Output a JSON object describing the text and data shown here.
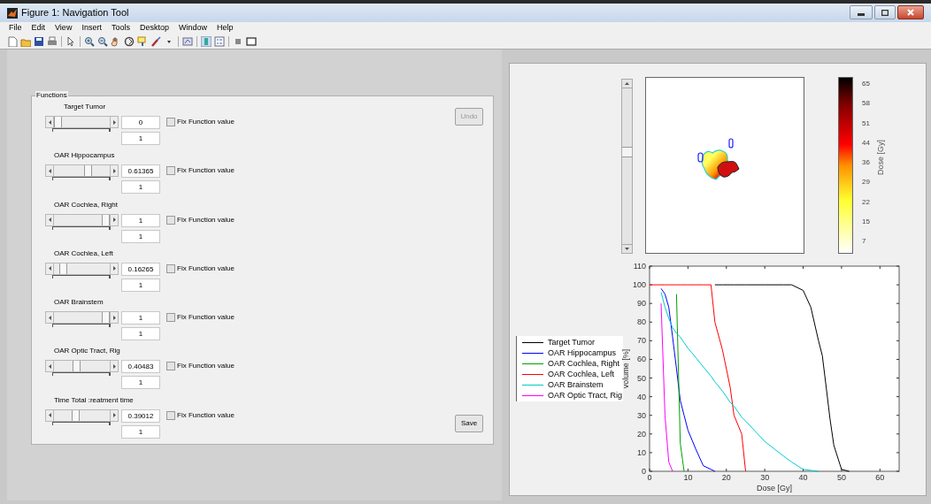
{
  "window": {
    "title": "Figure 1: Navigation Tool"
  },
  "menu": [
    "File",
    "Edit",
    "View",
    "Insert",
    "Tools",
    "Desktop",
    "Window",
    "Help"
  ],
  "functions_panel": {
    "title": "Functions",
    "rows": [
      {
        "label": "Target Tumor",
        "level": 0,
        "value": "0",
        "checkbox_label": "Fix Function value",
        "checked": false,
        "weight": "1"
      },
      {
        "label": "OAR Hippocampus",
        "level": 0.61365,
        "value": "0.61365",
        "checkbox_label": "Fix Function value",
        "checked": false,
        "weight": "1"
      },
      {
        "label": "OAR Cochlea, Right",
        "level": 1,
        "value": "1",
        "checkbox_label": "Fix Function value",
        "checked": false,
        "weight": "1"
      },
      {
        "label": "OAR Cochlea, Left",
        "level": 0.16265,
        "value": "0.16265",
        "checkbox_label": "Fix Function value",
        "checked": false,
        "weight": "1"
      },
      {
        "label": "OAR Brainstem",
        "level": 1,
        "value": "1",
        "checkbox_label": "Fix Function value",
        "checked": false,
        "weight": "1"
      },
      {
        "label": "OAR Optic Tract, Rig",
        "level": 0.40483,
        "value": "0.40483",
        "checkbox_label": "Fix Function value",
        "checked": false,
        "weight": "1"
      },
      {
        "label": "Time Total :reatment time",
        "level": 0.39012,
        "value": "0.39012",
        "checkbox_label": "Fix Function value",
        "checked": false,
        "weight": "1"
      }
    ]
  },
  "undo_button": {
    "label": "Undo",
    "disabled": true
  },
  "save_button": {
    "label": "Save",
    "disabled": false
  },
  "dose_map": {
    "colorbar_label": "Dose [Gy]",
    "colorbar_ticks": [
      "65",
      "58",
      "51",
      "44",
      "36",
      "29",
      "22",
      "15",
      "7"
    ]
  },
  "dvh": {
    "chart_data": {
      "type": "line",
      "xlabel": "Dose [Gy]",
      "ylabel": "volume [%]",
      "xlim": [
        0,
        65
      ],
      "ylim": [
        0,
        110
      ],
      "xticks": [
        0,
        10,
        20,
        30,
        40,
        50,
        60
      ],
      "yticks": [
        0,
        10,
        20,
        30,
        40,
        50,
        60,
        70,
        80,
        90,
        100,
        110
      ],
      "x": [
        0,
        2,
        3,
        4,
        5,
        6,
        7,
        8,
        9,
        10,
        12,
        14,
        16,
        17,
        19,
        21,
        22,
        24,
        25,
        30,
        35,
        37,
        40,
        42,
        44,
        45,
        46,
        47,
        48,
        50,
        52
      ],
      "series": [
        {
          "name": "Target Tumor",
          "color": "#000000",
          "values": [
            null,
            null,
            null,
            null,
            null,
            null,
            null,
            null,
            null,
            null,
            null,
            null,
            null,
            100,
            100,
            100,
            100,
            100,
            100,
            100,
            100,
            100,
            97,
            88,
            70,
            62,
            45,
            28,
            14,
            1,
            0
          ]
        },
        {
          "name": "OAR Hippocampus",
          "color": "#0000ff",
          "values": [
            null,
            null,
            98,
            95,
            88,
            72,
            55,
            38,
            30,
            22,
            12,
            3,
            1,
            0,
            null,
            null,
            null,
            null,
            null,
            null,
            null,
            null,
            null,
            null,
            null,
            null,
            null,
            null,
            null,
            null,
            null
          ]
        },
        {
          "name": "OAR Cochlea, Right",
          "color": "#00a000",
          "values": [
            null,
            null,
            null,
            null,
            null,
            null,
            95,
            15,
            0,
            null,
            null,
            null,
            null,
            null,
            null,
            null,
            null,
            null,
            null,
            null,
            null,
            null,
            null,
            null,
            null,
            null,
            null,
            null,
            null,
            null,
            null
          ]
        },
        {
          "name": "OAR Cochlea, Left",
          "color": "#ff0000",
          "values": [
            100,
            100,
            100,
            100,
            100,
            100,
            100,
            100,
            100,
            100,
            100,
            100,
            100,
            80,
            65,
            45,
            30,
            20,
            0,
            null,
            null,
            null,
            null,
            null,
            null,
            null,
            null,
            null,
            null,
            null,
            null
          ]
        },
        {
          "name": "OAR Brainstem",
          "color": "#00cccc",
          "values": [
            null,
            null,
            96,
            88,
            82,
            77,
            74,
            72,
            69,
            66,
            61,
            56,
            51,
            48,
            43,
            37,
            35,
            29,
            27,
            16,
            8,
            5,
            1,
            0.5,
            0,
            null,
            null,
            null,
            null,
            null,
            null
          ]
        },
        {
          "name": "OAR Optic Tract, Rig",
          "color": "#ff00ff",
          "values": [
            null,
            null,
            90,
            30,
            5,
            0,
            null,
            null,
            null,
            null,
            null,
            null,
            null,
            null,
            null,
            null,
            null,
            null,
            null,
            null,
            null,
            null,
            null,
            null,
            null,
            null,
            null,
            null,
            null,
            null,
            null
          ]
        }
      ]
    }
  }
}
